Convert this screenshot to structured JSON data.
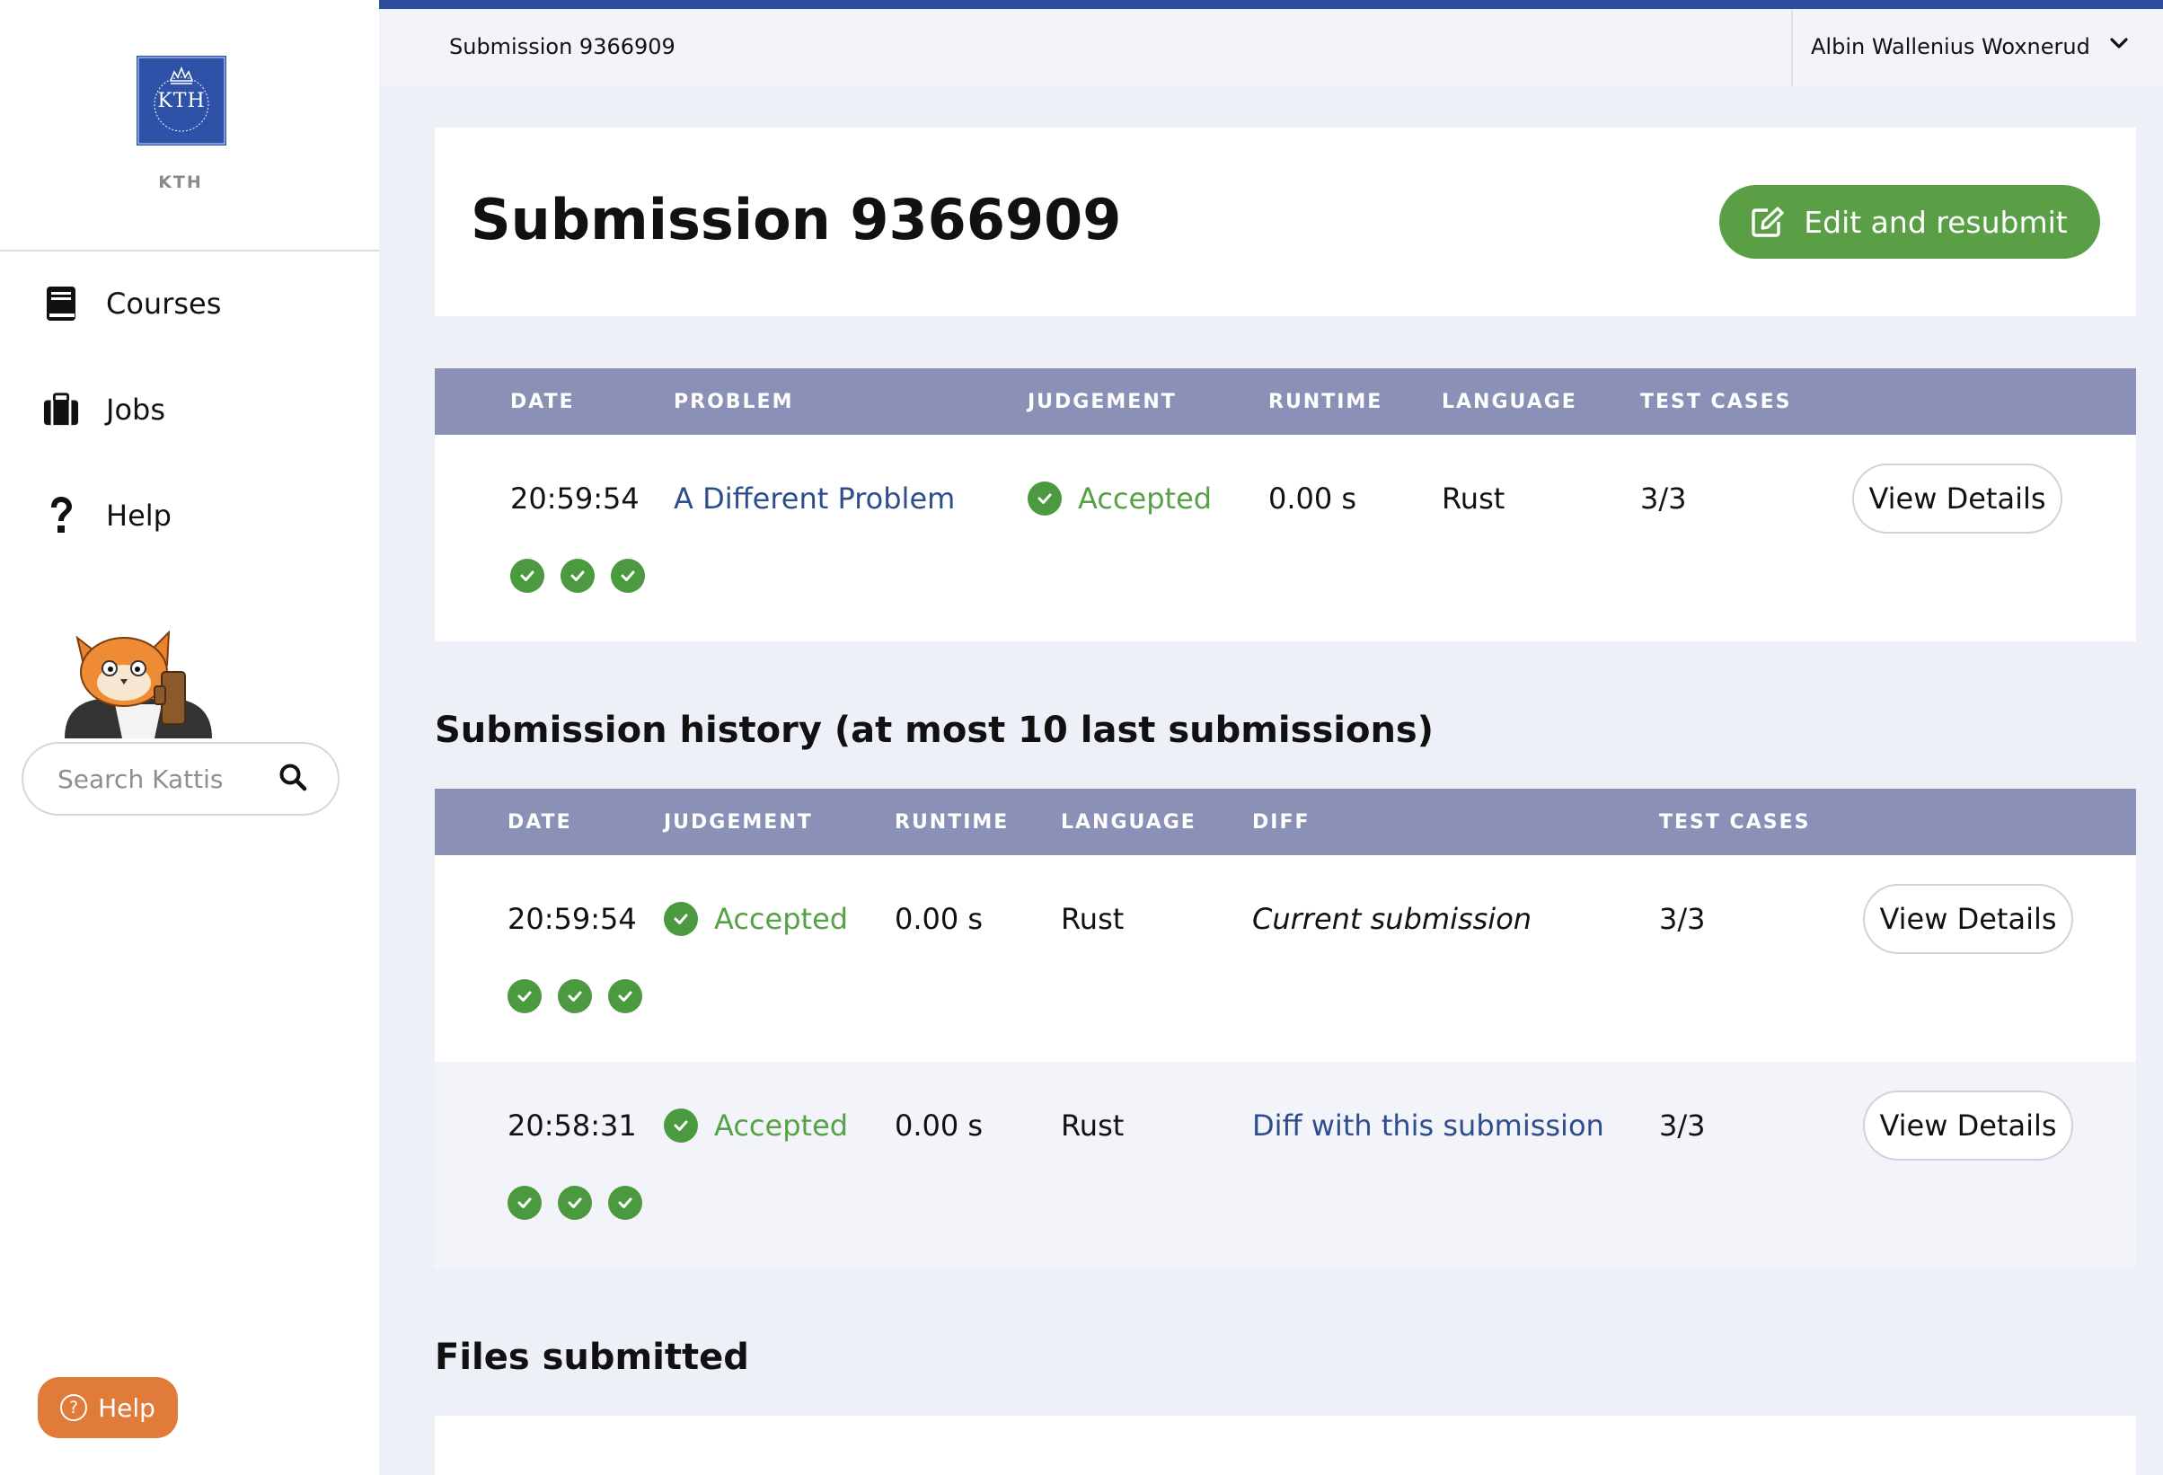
{
  "sidebar": {
    "logo_text": "KTH",
    "logo_caption": "KTH",
    "items": [
      {
        "label": "Courses",
        "icon": "book-icon"
      },
      {
        "label": "Jobs",
        "icon": "briefcase-icon"
      },
      {
        "label": "Help",
        "icon": "question-icon"
      }
    ],
    "search_placeholder": "Search Kattis",
    "help_button": "Help"
  },
  "topbar": {
    "breadcrumb": "Submission 9366909",
    "user": "Albin Wallenius Woxnerud"
  },
  "header": {
    "title": "Submission 9366909",
    "edit_button": "Edit and resubmit"
  },
  "submission": {
    "columns": [
      "DATE",
      "PROBLEM",
      "JUDGEMENT",
      "RUNTIME",
      "LANGUAGE",
      "TEST CASES"
    ],
    "row": {
      "date": "20:59:54",
      "problem": "A Different Problem",
      "judgement": "Accepted",
      "runtime": "0.00 s",
      "language": "Rust",
      "test_cases": "3/3",
      "tests_passed": 3,
      "details": "View Details"
    }
  },
  "history": {
    "title": "Submission history (at most 10 last submissions)",
    "columns": [
      "DATE",
      "JUDGEMENT",
      "RUNTIME",
      "LANGUAGE",
      "DIFF",
      "TEST CASES"
    ],
    "rows": [
      {
        "date": "20:59:54",
        "judgement": "Accepted",
        "runtime": "0.00 s",
        "language": "Rust",
        "diff": "Current submission",
        "test_cases": "3/3",
        "details": "View Details"
      },
      {
        "date": "20:58:31",
        "judgement": "Accepted",
        "runtime": "0.00 s",
        "language": "Rust",
        "diff": "Diff with this submission",
        "test_cases": "3/3",
        "details": "View Details"
      }
    ]
  },
  "files": {
    "title": "Files submitted"
  },
  "colors": {
    "accent_blue": "#2d4d9c",
    "table_header": "#8b90b7",
    "accepted_green": "#56a146",
    "button_green": "#5a9f45",
    "help_orange": "#e07b39"
  }
}
